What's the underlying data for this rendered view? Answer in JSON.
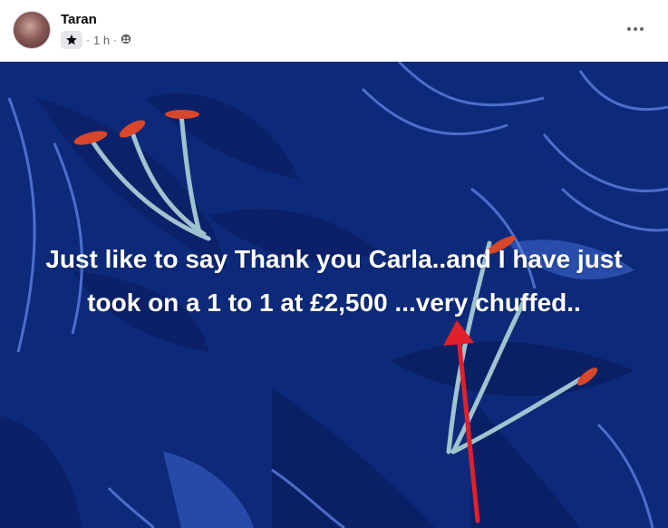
{
  "post": {
    "author": "Taran",
    "time": "1 h",
    "separator": "·",
    "badge_icon": "star-icon",
    "audience_icon": "group-icon",
    "more_icon": "more-horizontal-icon",
    "body_text": "Just like to say Thank you Carla..and I have just took on a 1 to 1 at £2,500 ...very chuffed..",
    "background_color": "#0d2a7a",
    "arrow_color": "#e0202a"
  }
}
